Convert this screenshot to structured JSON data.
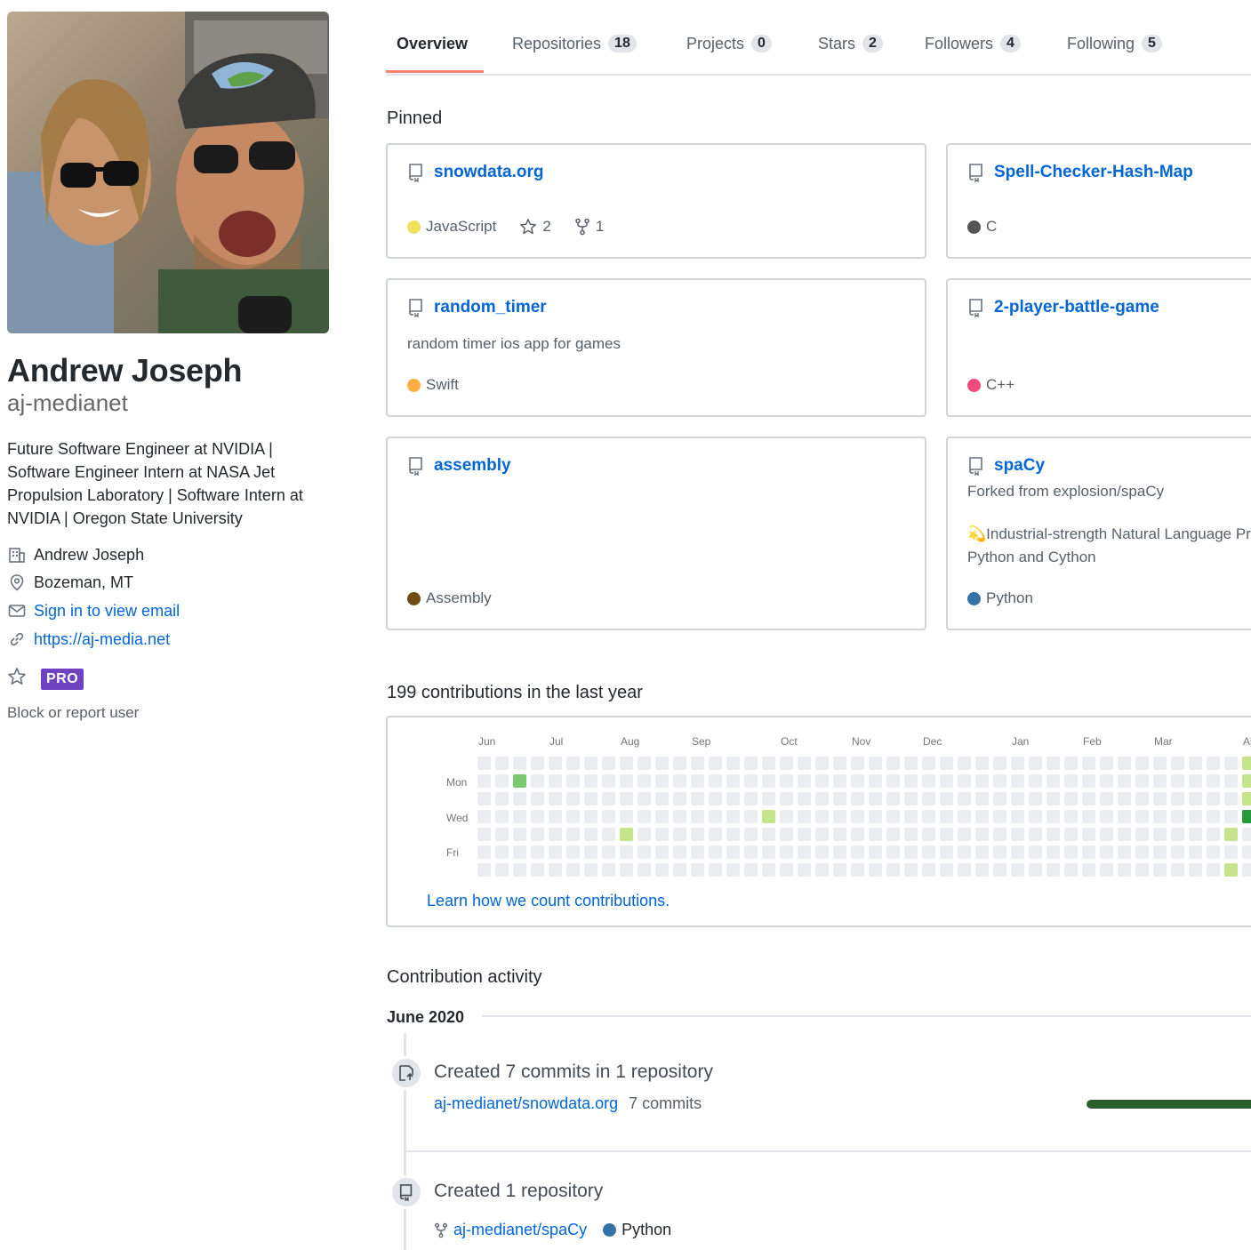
{
  "profile": {
    "fullname": "Andrew Joseph",
    "username": "aj-medianet",
    "bio": "Future Software Engineer at NVIDIA | Software Engineer Intern at NASA Jet Propulsion Laboratory | Software Intern at NVIDIA | Oregon State University",
    "company": "Andrew Joseph",
    "location": "Bozeman, MT",
    "email": "Sign in to view email",
    "website": "https://aj-media.net",
    "badge": "PRO",
    "block_link": "Block or report user"
  },
  "tabs": [
    {
      "label": "Overview",
      "count": null,
      "active": true
    },
    {
      "label": "Repositories",
      "count": "18"
    },
    {
      "label": "Projects",
      "count": "0"
    },
    {
      "label": "Stars",
      "count": "2"
    },
    {
      "label": "Followers",
      "count": "4"
    },
    {
      "label": "Following",
      "count": "5"
    }
  ],
  "pinned": {
    "title": "Pinned",
    "repos": [
      {
        "name": "snowdata.org",
        "desc": "",
        "lang": "JavaScript",
        "lang_color": "#f1e05a",
        "stars": "2",
        "forks": "1"
      },
      {
        "name": "Spell-Checker-Hash-Map",
        "desc": "",
        "lang": "C",
        "lang_color": "#555555"
      },
      {
        "name": "random_timer",
        "desc": "random timer ios app for games",
        "lang": "Swift",
        "lang_color": "#ffac45"
      },
      {
        "name": "2-player-battle-game",
        "desc": "",
        "lang": "C++",
        "lang_color": "#f34b7d"
      },
      {
        "name": "assembly",
        "desc": "",
        "lang": "Assembly",
        "lang_color": "#6E4C13"
      },
      {
        "name": "spaCy",
        "forked_from": "Forked from explosion/spaCy",
        "desc_line1": "💫Industrial-strength Natural Language Processing (NLP) with",
        "desc_line2": "Python and Cython",
        "lang": "Python",
        "lang_color": "#3572A5"
      }
    ]
  },
  "contributions": {
    "title": "199 contributions in the last year",
    "months": [
      "Jun",
      "Jul",
      "Aug",
      "Sep",
      "Oct",
      "Nov",
      "Dec",
      "Jan",
      "Feb",
      "Mar",
      "Ap"
    ],
    "days": [
      "Mon",
      "Wed",
      "Fri"
    ],
    "learn_link": "Learn how we count contributions.",
    "level_colors": [
      "#ebedf0",
      "#c6e48b",
      "#7bc96f",
      "#239a3b"
    ]
  },
  "activity": {
    "title": "Contribution activity",
    "month": "June 2020",
    "items": [
      {
        "title": "Created 7 commits in 1 repository",
        "repo": "aj-medianet/snowdata.org",
        "detail": "7 commits",
        "progress": 1.0
      },
      {
        "title": "Created 1 repository",
        "repo": "aj-medianet/spaCy",
        "lang": "Python",
        "lang_color": "#3572A5"
      }
    ]
  }
}
